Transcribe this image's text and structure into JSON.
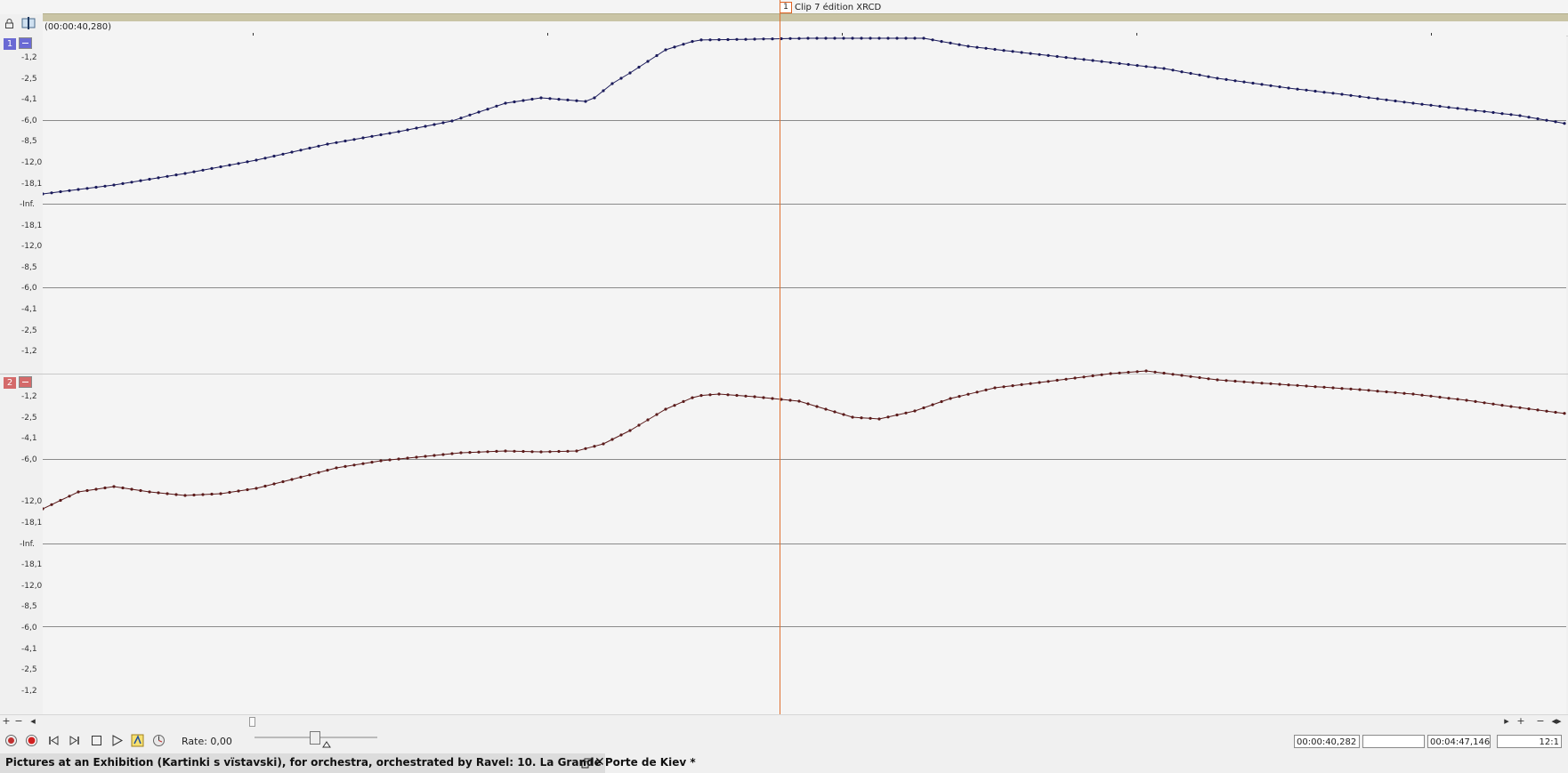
{
  "clip": {
    "number": "1",
    "title": "Clip 7 édition XRCD"
  },
  "ruler": {
    "time": "(00:00:40,280)"
  },
  "db_scale": [
    "-1,2",
    "-2,5",
    "-4,1",
    "-6,0",
    "-8,5",
    "-12,0",
    "-18,1",
    "-Inf.",
    "-18,1",
    "-12,0",
    "-8,5",
    "-6,0",
    "-4,1",
    "-2,5",
    "-1,2"
  ],
  "db_scale_track2": [
    "-1,2",
    "-2,5",
    "-4,1",
    "-6,0",
    "-12,0",
    "-18,1",
    "-Inf.",
    "-18,1",
    "-12,0",
    "-8,5",
    "-6,0",
    "-4,1",
    "-2,5",
    "-1,2"
  ],
  "tracks": [
    {
      "number": "1",
      "color": "#6a6ad4",
      "line_color": "#1a1a5a"
    },
    {
      "number": "2",
      "color": "#d46a6a",
      "line_color": "#5a1a1a"
    }
  ],
  "transport": {
    "rate_label": "Rate: 0,00",
    "position": "00:00:40,282",
    "selection": "",
    "length": "00:04:47,146",
    "zoom": "12:1"
  },
  "status": {
    "document_title": "Pictures at an Exhibition (Kartinki s vïstavski), for orchestra, orchestrated by Ravel: 10. La Grande Porte de Kiev *"
  },
  "icons": [
    "lock-icon",
    "snap-icon",
    "record-arm-icon",
    "record-icon",
    "go-start-icon",
    "go-end-icon",
    "stop-icon",
    "play-icon",
    "loop-icon",
    "metronome-icon",
    "restore-icon",
    "close-icon"
  ]
}
